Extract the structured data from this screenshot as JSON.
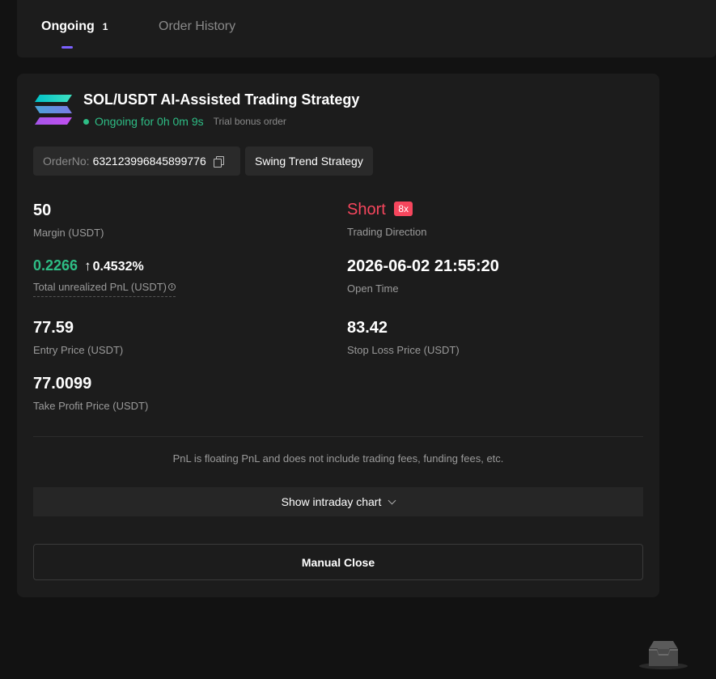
{
  "tabs": {
    "ongoing_label": "Ongoing",
    "ongoing_count": "1",
    "history_label": "Order History"
  },
  "order": {
    "title": "SOL/USDT AI-Assisted Trading Strategy",
    "status": "Ongoing for 0h 0m 9s",
    "trial_note": "Trial bonus order",
    "order_no_label": "OrderNo:",
    "order_no": "632123996845899776",
    "strategy_tag": "Swing Trend Strategy",
    "logo_icon": "solana-logo-icon"
  },
  "metrics": {
    "margin": {
      "value": "50",
      "label": "Margin (USDT)"
    },
    "direction": {
      "value": "Short",
      "leverage": "8x",
      "label": "Trading Direction"
    },
    "pnl": {
      "value": "0.2266",
      "arrow": "↑",
      "percent": "0.4532%",
      "label": "Total unrealized PnL (USDT)"
    },
    "open_time": {
      "value": "2026-06-02 21:55:20",
      "label": "Open Time"
    },
    "entry_price": {
      "value": "77.59",
      "label": "Entry Price (USDT)"
    },
    "stop_loss": {
      "value": "83.42",
      "label": "Stop Loss Price (USDT)"
    },
    "take_profit": {
      "value": "77.0099",
      "label": "Take Profit Price (USDT)"
    }
  },
  "footer": {
    "disclaimer": "PnL is floating PnL and does not include trading fees, funding fees, etc.",
    "chart_toggle": "Show intraday chart",
    "close_button": "Manual Close"
  },
  "colors": {
    "accent": "#7b61ff",
    "positive": "#2ebd85",
    "negative": "#f6465d",
    "background": "#121212",
    "card": "#1c1c1c"
  }
}
